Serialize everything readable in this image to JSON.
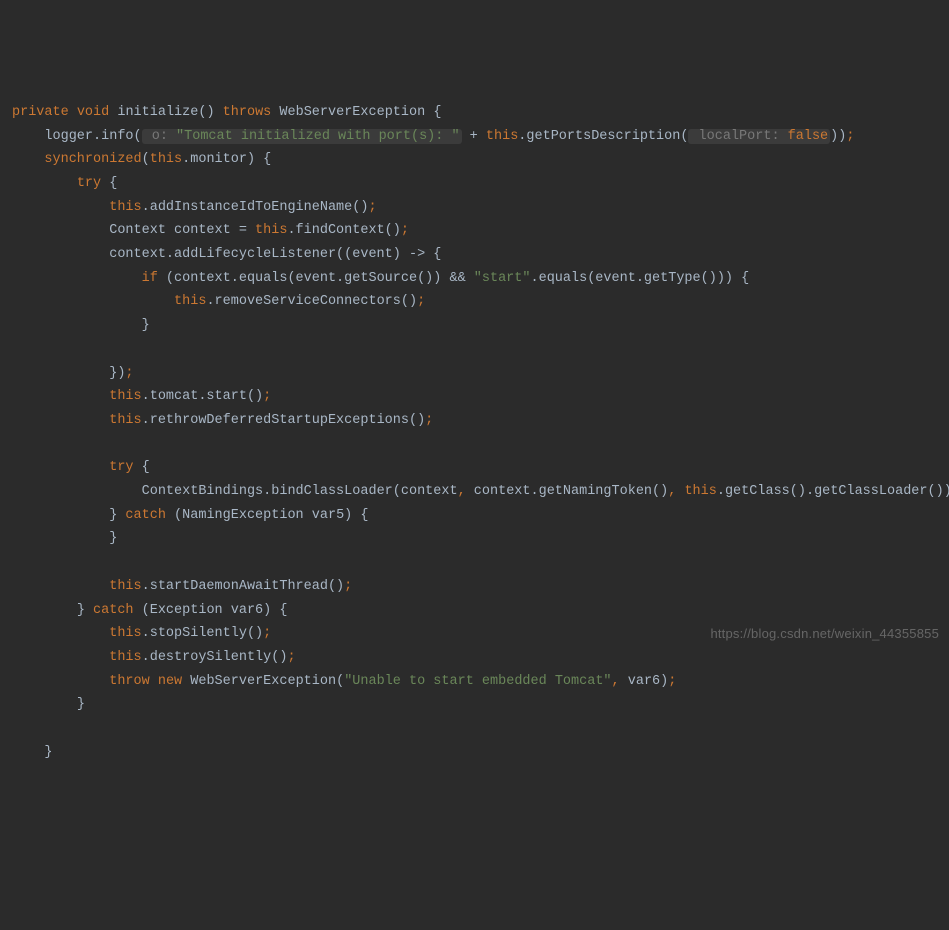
{
  "code": {
    "l1": {
      "k1": "private",
      "k2": "void",
      "name": "initialize",
      "p": "() ",
      "k3": "throws",
      "ex": "WebServerException",
      "brace": " {"
    },
    "l2": {
      "ind": "    ",
      "a": "logger.info(",
      "hint": " o: ",
      "str": "\"Tomcat initialized with port(s): \"",
      "b": " + ",
      "this": "this",
      "c": ".getPortsDescription(",
      "hint2": " localPort: ",
      "false": "false",
      "d": "))",
      "semi": ";"
    },
    "l3": {
      "ind": "    ",
      "sync": "synchronized",
      "a": "(",
      "this": "this",
      "b": ".monitor) {"
    },
    "l4": {
      "ind": "        ",
      "try": "try",
      "a": " {"
    },
    "l5": {
      "ind": "            ",
      "this": "this",
      "a": ".addInstanceIdToEngineName()",
      "semi": ";"
    },
    "l6": {
      "ind": "            ",
      "a": "Context context = ",
      "this": "this",
      "b": ".findContext()",
      "semi": ";"
    },
    "l7": {
      "ind": "            ",
      "a": "context.addLifecycleListener((event) -> {"
    },
    "l8": {
      "ind": "                ",
      "if": "if",
      "a": " (context.equals(event.getSource()) && ",
      "str": "\"start\"",
      "b": ".equals(event.getType())) {"
    },
    "l9": {
      "ind": "                    ",
      "this": "this",
      "a": ".removeServiceConnectors()",
      "semi": ";"
    },
    "l10": {
      "ind": "                ",
      "a": "}"
    },
    "blank1": "",
    "l11": {
      "ind": "            ",
      "a": "})",
      "semi": ";"
    },
    "l12": {
      "ind": "            ",
      "this": "this",
      "a": ".tomcat.start()",
      "semi": ";"
    },
    "l13": {
      "ind": "            ",
      "this": "this",
      "a": ".rethrowDeferredStartupExceptions()",
      "semi": ";"
    },
    "blank2": "",
    "l14": {
      "ind": "            ",
      "try": "try",
      "a": " {"
    },
    "l15": {
      "ind": "                ",
      "a": "ContextBindings.bindClassLoader(context",
      "c1": ",",
      "b": " context.getNamingToken()",
      "c2": ",",
      "sp": " ",
      "this": "this",
      "d": ".getClass().getClassLoader())",
      "semi": ";"
    },
    "l16": {
      "ind": "            ",
      "a": "} ",
      "catch": "catch",
      "b": " (NamingException var5) {"
    },
    "l17": {
      "ind": "            ",
      "a": "}"
    },
    "blank3": "",
    "l18": {
      "ind": "            ",
      "this": "this",
      "a": ".startDaemonAwaitThread()",
      "semi": ";"
    },
    "l19": {
      "ind": "        ",
      "a": "} ",
      "catch": "catch",
      "b": " (Exception var6) {"
    },
    "l20": {
      "ind": "            ",
      "this": "this",
      "a": ".stopSilently()",
      "semi": ";"
    },
    "l21": {
      "ind": "            ",
      "this": "this",
      "a": ".destroySilently()",
      "semi": ";"
    },
    "l22": {
      "ind": "            ",
      "throw": "throw",
      "sp": " ",
      "new": "new",
      "a": " WebServerException(",
      "str": "\"Unable to start embedded Tomcat\"",
      "c1": ",",
      "b": " var6)",
      "semi": ";"
    },
    "l23": {
      "ind": "        ",
      "a": "}"
    },
    "blank4": "",
    "l24": {
      "ind": "    ",
      "a": "}"
    }
  },
  "watermark": "https://blog.csdn.net/weixin_44355855"
}
